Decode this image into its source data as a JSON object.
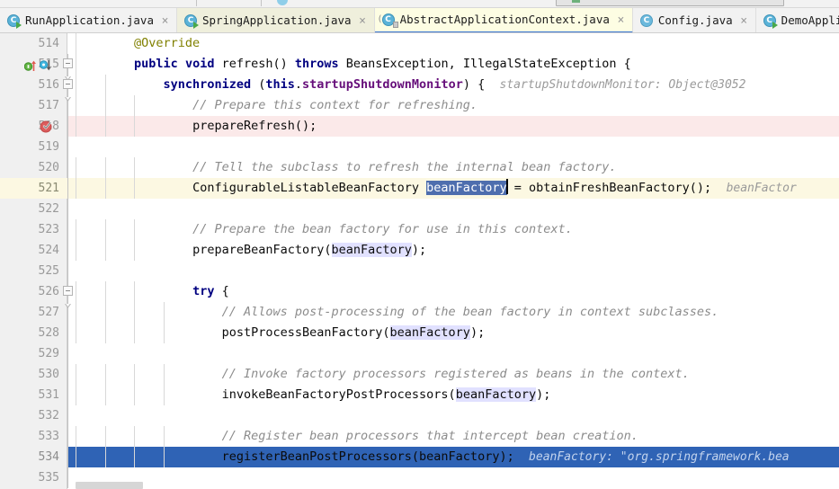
{
  "window": {
    "title": "AbstractApplicationContext.java"
  },
  "toolbar": {
    "icons": [
      "build-icon",
      "save-icon",
      "vcs-icon",
      "search-icon",
      "run-config-box",
      "run-icon",
      "debug-icon",
      "stop-icon",
      "layout-icon"
    ]
  },
  "tabs": [
    {
      "label": "RunApplication.java",
      "icon": "java-runnable-class-icon",
      "close": "×",
      "state": "inactive"
    },
    {
      "label": "SpringApplication.java",
      "icon": "java-runnable-class-icon",
      "close": "×",
      "state": "modified"
    },
    {
      "label": "AbstractApplicationContext.java",
      "icon": "java-abstract-class-icon",
      "close": "×",
      "state": "active"
    },
    {
      "label": "Config.java",
      "icon": "java-class-icon",
      "close": "×",
      "state": "inactive"
    },
    {
      "label": "DemoApplication.ja",
      "icon": "java-runnable-class-icon",
      "close": "",
      "state": "inactive"
    }
  ],
  "editor": {
    "selected_text": "beanFactory",
    "execution_line": 534,
    "breakpoint_line": 518,
    "caret_line": 521,
    "colors": {
      "keyword": "#000080",
      "comment": "#8c8c8c",
      "annotation": "#808000",
      "field": "#660e7a",
      "selection": "#4e6eae",
      "execution_line_bg": "#2f63b5",
      "breakpoint_line_bg": "#fbe9e9",
      "caret_line_bg": "#fcf8e2",
      "identifier_highlight": "#e1e1ff",
      "inline_hint": "#9a9a9a"
    },
    "lines": [
      {
        "n": "514",
        "indent": 2,
        "tokens": [
          {
            "t": "@Override",
            "c": "ann"
          }
        ]
      },
      {
        "n": "515",
        "indent": 2,
        "markers": [
          "override-marker",
          "implementation-marker"
        ],
        "fold": "start",
        "tokens": [
          {
            "t": "public",
            "c": "kw"
          },
          {
            "t": " ",
            "c": "plain"
          },
          {
            "t": "void",
            "c": "kw"
          },
          {
            "t": " refresh() ",
            "c": "plain"
          },
          {
            "t": "throws",
            "c": "kw"
          },
          {
            "t": " BeansException, IllegalStateException {",
            "c": "plain"
          }
        ]
      },
      {
        "n": "516",
        "indent": 3,
        "fold": "start",
        "tokens": [
          {
            "t": "synchronized",
            "c": "kw"
          },
          {
            "t": " (",
            "c": "plain"
          },
          {
            "t": "this",
            "c": "kw"
          },
          {
            "t": ".",
            "c": "plain"
          },
          {
            "t": "startupShutdownMonitor",
            "c": "fld"
          },
          {
            "t": ") {",
            "c": "plain"
          }
        ],
        "hint": "startupShutdownMonitor: Object@3052"
      },
      {
        "n": "517",
        "indent": 4,
        "tokens": [
          {
            "t": "// Prepare this context for refreshing.",
            "c": "cmt"
          }
        ]
      },
      {
        "n": "518",
        "indent": 4,
        "breakpoint": true,
        "tokens": [
          {
            "t": "prepareRefresh();",
            "c": "plain"
          }
        ]
      },
      {
        "n": "519",
        "indent": 0,
        "tokens": []
      },
      {
        "n": "520",
        "indent": 4,
        "tokens": [
          {
            "t": "// Tell the subclass to refresh the internal bean factory.",
            "c": "cmt"
          }
        ]
      },
      {
        "n": "521",
        "indent": 4,
        "caret": true,
        "tokens": [
          {
            "t": "ConfigurableListableBeanFactory ",
            "c": "plain"
          },
          {
            "t": "beanFactory",
            "c": "sel"
          },
          {
            "t": "|caret|",
            "c": "caret"
          },
          {
            "t": " = obtainFreshBeanFactory();",
            "c": "plain"
          }
        ],
        "hint": "beanFactor"
      },
      {
        "n": "522",
        "indent": 0,
        "tokens": []
      },
      {
        "n": "523",
        "indent": 4,
        "tokens": [
          {
            "t": "// Prepare the bean factory for use in this context.",
            "c": "cmt"
          }
        ]
      },
      {
        "n": "524",
        "indent": 4,
        "tokens": [
          {
            "t": "prepareBeanFactory(",
            "c": "plain"
          },
          {
            "t": "beanFactory",
            "c": "hl"
          },
          {
            "t": ");",
            "c": "plain"
          }
        ]
      },
      {
        "n": "525",
        "indent": 0,
        "tokens": []
      },
      {
        "n": "526",
        "indent": 4,
        "fold": "start",
        "tokens": [
          {
            "t": "try",
            "c": "kw"
          },
          {
            "t": " {",
            "c": "plain"
          }
        ]
      },
      {
        "n": "527",
        "indent": 5,
        "tokens": [
          {
            "t": "// Allows post-processing of the bean factory in context subclasses.",
            "c": "cmt"
          }
        ]
      },
      {
        "n": "528",
        "indent": 5,
        "tokens": [
          {
            "t": "postProcessBeanFactory(",
            "c": "plain"
          },
          {
            "t": "beanFactory",
            "c": "hl"
          },
          {
            "t": ");",
            "c": "plain"
          }
        ]
      },
      {
        "n": "529",
        "indent": 0,
        "tokens": []
      },
      {
        "n": "530",
        "indent": 5,
        "tokens": [
          {
            "t": "// Invoke factory processors registered as beans in the context.",
            "c": "cmt"
          }
        ]
      },
      {
        "n": "531",
        "indent": 5,
        "tokens": [
          {
            "t": "invokeBeanFactoryPostProcessors(",
            "c": "plain"
          },
          {
            "t": "beanFactory",
            "c": "hl"
          },
          {
            "t": ");",
            "c": "plain"
          }
        ]
      },
      {
        "n": "532",
        "indent": 0,
        "tokens": []
      },
      {
        "n": "533",
        "indent": 5,
        "tokens": [
          {
            "t": "// Register bean processors that intercept bean creation.",
            "c": "cmt"
          }
        ]
      },
      {
        "n": "534",
        "indent": 5,
        "exec": true,
        "tokens": [
          {
            "t": "registerBeanPostProcessors(beanFactory);",
            "c": "plain"
          }
        ],
        "hint": "beanFactory: \"org.springframework.bea"
      },
      {
        "n": "535",
        "indent": 0,
        "tokens": []
      }
    ]
  },
  "scrollbar": {
    "orientation": "horizontal",
    "name": "horizontal-scrollbar"
  }
}
